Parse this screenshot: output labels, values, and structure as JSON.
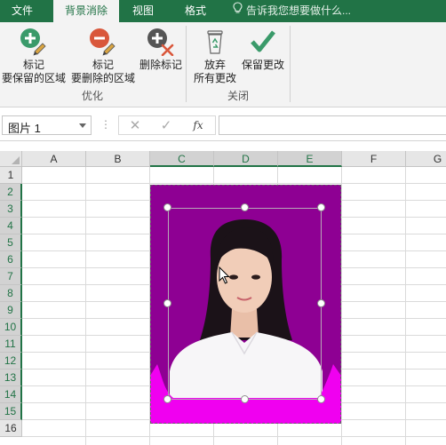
{
  "tabs": {
    "file": "文件",
    "background_removal": "背景消除",
    "view": "视图",
    "format": "格式",
    "tell_me": "告诉我您想要做什么..."
  },
  "ribbon": {
    "keep_line1": "标记",
    "keep_line2": "要保留的区域",
    "remove_line1": "标记",
    "remove_line2": "要删除的区域",
    "delete_mark": "删除标记",
    "discard_line1": "放弃",
    "discard_line2": "所有更改",
    "save_changes": "保留更改",
    "group_optimize": "优化",
    "group_close": "关闭"
  },
  "formula_bar": {
    "name_box": "图片 1",
    "fx": "fx",
    "formula": ""
  },
  "grid": {
    "columns": [
      "A",
      "B",
      "C",
      "D",
      "E",
      "F",
      "G"
    ],
    "rows": [
      "1",
      "2",
      "3",
      "4",
      "5",
      "6",
      "7",
      "8",
      "9",
      "10",
      "11",
      "12",
      "13",
      "14",
      "15",
      "16"
    ],
    "selected_columns": [
      "C",
      "D",
      "E"
    ],
    "selected_rows": [
      "2",
      "3",
      "4",
      "5",
      "6",
      "7",
      "8",
      "9",
      "10",
      "11",
      "12",
      "13",
      "14",
      "15"
    ]
  },
  "colors": {
    "excel_green": "#217346",
    "removed_area_magenta": "#8e0093",
    "kept_area_pink": "#f000f0"
  },
  "icons": {
    "keep": "plus-circle-pencil-icon",
    "remove": "minus-circle-pencil-icon",
    "delete_mark": "x-circle-icon",
    "discard": "recycle-bin-icon",
    "save": "checkmark-icon"
  }
}
